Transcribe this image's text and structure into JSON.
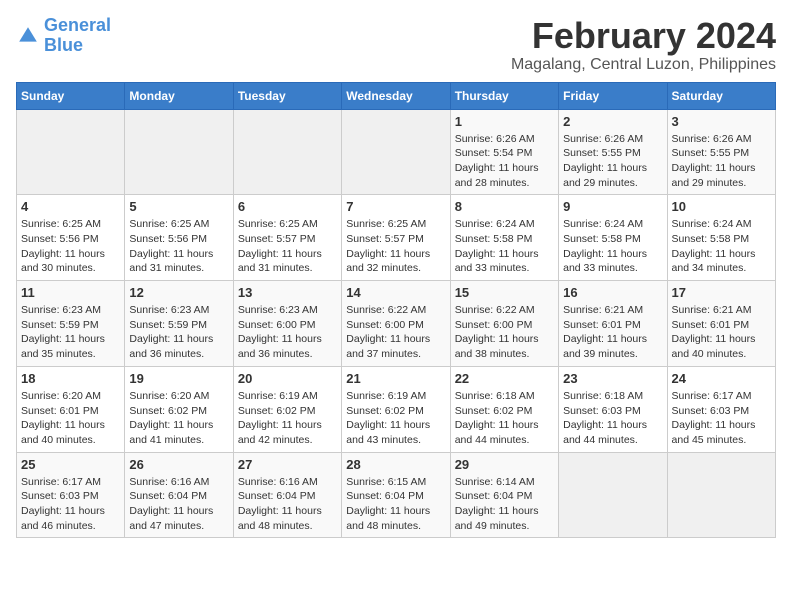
{
  "logo": {
    "line1": "General",
    "line2": "Blue"
  },
  "title": "February 2024",
  "subtitle": "Magalang, Central Luzon, Philippines",
  "days_of_week": [
    "Sunday",
    "Monday",
    "Tuesday",
    "Wednesday",
    "Thursday",
    "Friday",
    "Saturday"
  ],
  "weeks": [
    [
      {
        "day": "",
        "empty": true
      },
      {
        "day": "",
        "empty": true
      },
      {
        "day": "",
        "empty": true
      },
      {
        "day": "",
        "empty": true
      },
      {
        "day": "1",
        "sunrise": "6:26 AM",
        "sunset": "5:54 PM",
        "daylight": "11 hours and 28 minutes."
      },
      {
        "day": "2",
        "sunrise": "6:26 AM",
        "sunset": "5:55 PM",
        "daylight": "11 hours and 29 minutes."
      },
      {
        "day": "3",
        "sunrise": "6:26 AM",
        "sunset": "5:55 PM",
        "daylight": "11 hours and 29 minutes."
      }
    ],
    [
      {
        "day": "4",
        "sunrise": "6:25 AM",
        "sunset": "5:56 PM",
        "daylight": "11 hours and 30 minutes."
      },
      {
        "day": "5",
        "sunrise": "6:25 AM",
        "sunset": "5:56 PM",
        "daylight": "11 hours and 31 minutes."
      },
      {
        "day": "6",
        "sunrise": "6:25 AM",
        "sunset": "5:57 PM",
        "daylight": "11 hours and 31 minutes."
      },
      {
        "day": "7",
        "sunrise": "6:25 AM",
        "sunset": "5:57 PM",
        "daylight": "11 hours and 32 minutes."
      },
      {
        "day": "8",
        "sunrise": "6:24 AM",
        "sunset": "5:58 PM",
        "daylight": "11 hours and 33 minutes."
      },
      {
        "day": "9",
        "sunrise": "6:24 AM",
        "sunset": "5:58 PM",
        "daylight": "11 hours and 33 minutes."
      },
      {
        "day": "10",
        "sunrise": "6:24 AM",
        "sunset": "5:58 PM",
        "daylight": "11 hours and 34 minutes."
      }
    ],
    [
      {
        "day": "11",
        "sunrise": "6:23 AM",
        "sunset": "5:59 PM",
        "daylight": "11 hours and 35 minutes."
      },
      {
        "day": "12",
        "sunrise": "6:23 AM",
        "sunset": "5:59 PM",
        "daylight": "11 hours and 36 minutes."
      },
      {
        "day": "13",
        "sunrise": "6:23 AM",
        "sunset": "6:00 PM",
        "daylight": "11 hours and 36 minutes."
      },
      {
        "day": "14",
        "sunrise": "6:22 AM",
        "sunset": "6:00 PM",
        "daylight": "11 hours and 37 minutes."
      },
      {
        "day": "15",
        "sunrise": "6:22 AM",
        "sunset": "6:00 PM",
        "daylight": "11 hours and 38 minutes."
      },
      {
        "day": "16",
        "sunrise": "6:21 AM",
        "sunset": "6:01 PM",
        "daylight": "11 hours and 39 minutes."
      },
      {
        "day": "17",
        "sunrise": "6:21 AM",
        "sunset": "6:01 PM",
        "daylight": "11 hours and 40 minutes."
      }
    ],
    [
      {
        "day": "18",
        "sunrise": "6:20 AM",
        "sunset": "6:01 PM",
        "daylight": "11 hours and 40 minutes."
      },
      {
        "day": "19",
        "sunrise": "6:20 AM",
        "sunset": "6:02 PM",
        "daylight": "11 hours and 41 minutes."
      },
      {
        "day": "20",
        "sunrise": "6:19 AM",
        "sunset": "6:02 PM",
        "daylight": "11 hours and 42 minutes."
      },
      {
        "day": "21",
        "sunrise": "6:19 AM",
        "sunset": "6:02 PM",
        "daylight": "11 hours and 43 minutes."
      },
      {
        "day": "22",
        "sunrise": "6:18 AM",
        "sunset": "6:02 PM",
        "daylight": "11 hours and 44 minutes."
      },
      {
        "day": "23",
        "sunrise": "6:18 AM",
        "sunset": "6:03 PM",
        "daylight": "11 hours and 44 minutes."
      },
      {
        "day": "24",
        "sunrise": "6:17 AM",
        "sunset": "6:03 PM",
        "daylight": "11 hours and 45 minutes."
      }
    ],
    [
      {
        "day": "25",
        "sunrise": "6:17 AM",
        "sunset": "6:03 PM",
        "daylight": "11 hours and 46 minutes."
      },
      {
        "day": "26",
        "sunrise": "6:16 AM",
        "sunset": "6:04 PM",
        "daylight": "11 hours and 47 minutes."
      },
      {
        "day": "27",
        "sunrise": "6:16 AM",
        "sunset": "6:04 PM",
        "daylight": "11 hours and 48 minutes."
      },
      {
        "day": "28",
        "sunrise": "6:15 AM",
        "sunset": "6:04 PM",
        "daylight": "11 hours and 48 minutes."
      },
      {
        "day": "29",
        "sunrise": "6:14 AM",
        "sunset": "6:04 PM",
        "daylight": "11 hours and 49 minutes."
      },
      {
        "day": "",
        "empty": true
      },
      {
        "day": "",
        "empty": true
      }
    ]
  ],
  "labels": {
    "sunrise": "Sunrise:",
    "sunset": "Sunset:",
    "daylight": "Daylight:"
  }
}
